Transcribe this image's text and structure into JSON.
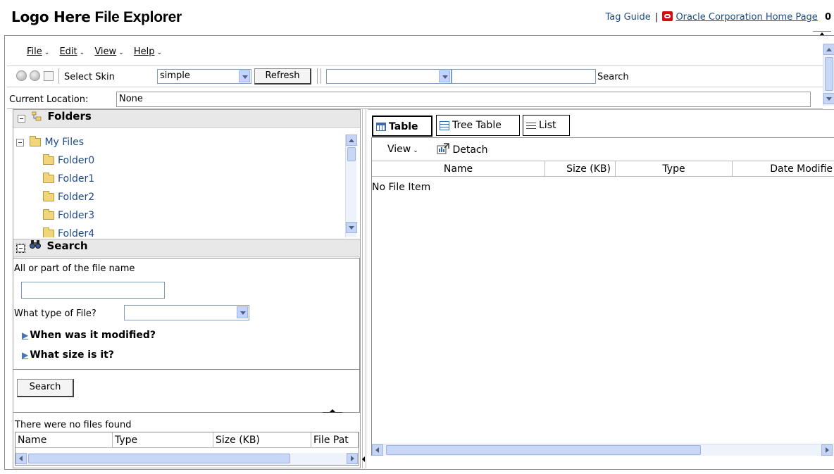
{
  "header": {
    "logo_text": "Logo Here",
    "app_title": "File Explorer",
    "tag_guide_link": "Tag Guide",
    "separator": "|",
    "oracle_link": "Oracle Corporation Home Page",
    "tail_text": "0"
  },
  "menubar": {
    "items": [
      {
        "label": "File"
      },
      {
        "label": "Edit"
      },
      {
        "label": "View"
      },
      {
        "label": "Help"
      }
    ]
  },
  "toolbar": {
    "skin_label": "Select Skin",
    "skin_value": "simple",
    "refresh_label": "Refresh",
    "search_type_value": "",
    "search_text_value": "",
    "search_label": "Search"
  },
  "location": {
    "label": "Current Location:",
    "value": "None"
  },
  "folders_panel": {
    "title": "Folders",
    "root": "My Files",
    "items": [
      "Folder0",
      "Folder1",
      "Folder2",
      "Folder3",
      "Folder4"
    ]
  },
  "search_panel": {
    "title": "Search",
    "filename_label": "All or part of the file name",
    "filename_value": "",
    "filetype_label": "What type of File?",
    "filetype_value": "",
    "modified_label": "When was it modified?",
    "size_label": "What size is it?",
    "search_button": "Search",
    "results_message": "There were no files found",
    "results_columns": [
      "Name",
      "Type",
      "Size (KB)",
      "File Pat"
    ]
  },
  "content": {
    "tabs": [
      {
        "label": "Table",
        "active": true
      },
      {
        "label": "Tree Table",
        "active": false
      },
      {
        "label": "List",
        "active": false
      }
    ],
    "view_menu": "View",
    "detach_label": "Detach",
    "columns": [
      "Name",
      "Size (KB)",
      "Type",
      "Date Modifie"
    ],
    "empty_message": "No File Item"
  }
}
